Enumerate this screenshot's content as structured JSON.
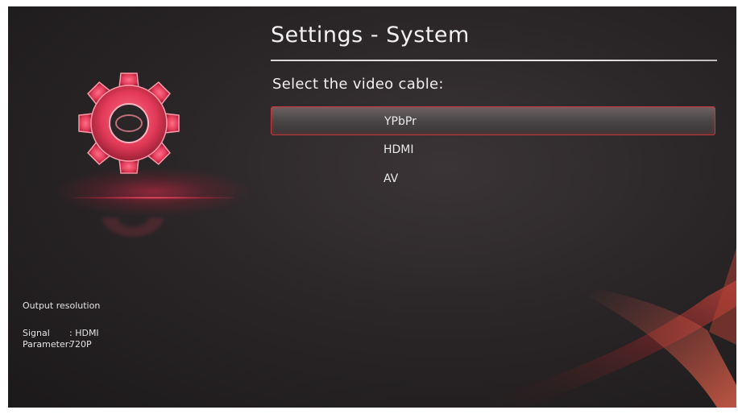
{
  "page": {
    "title": "Settings - System",
    "prompt": "Select the video cable:"
  },
  "options": [
    {
      "label": "YPbPr",
      "selected": true
    },
    {
      "label": "HDMI",
      "selected": false
    },
    {
      "label": "AV",
      "selected": false
    }
  ],
  "info": {
    "heading": "Output resolution",
    "signal_label": "Signal",
    "signal_value": ": HDMI",
    "parameter_label": "Parameter:",
    "parameter_value": "720P"
  },
  "icons": {
    "hero": "gear-icon"
  },
  "colors": {
    "accent": "#c0393d",
    "background": "#2a2628",
    "gear": "#e8415e"
  }
}
